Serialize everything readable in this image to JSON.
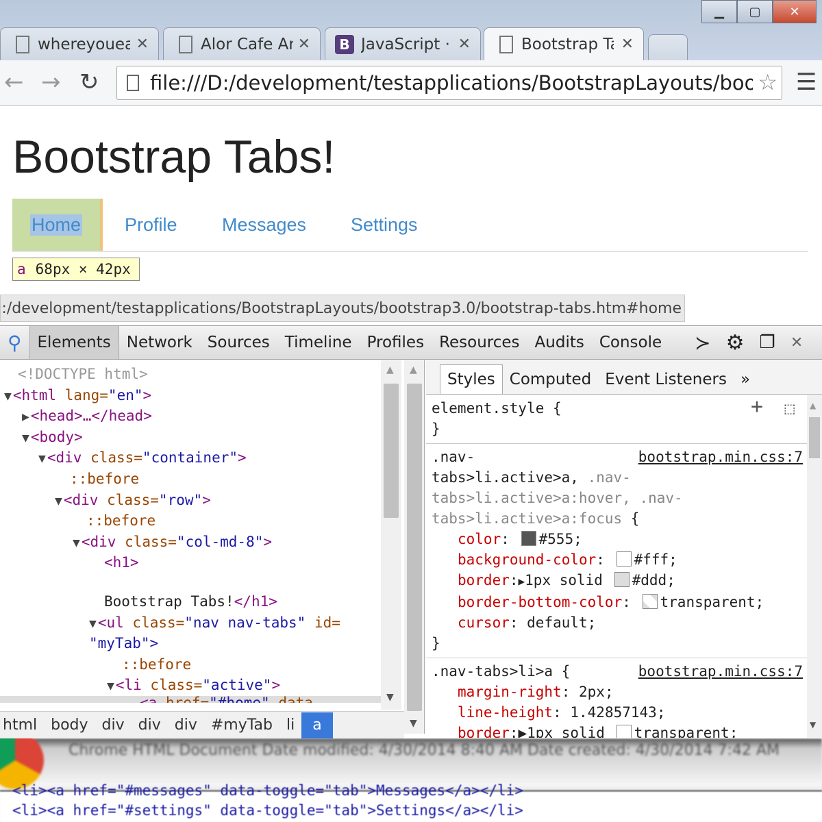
{
  "browser": {
    "tabs": [
      {
        "title": "whereyoueat",
        "icon": "page-icon"
      },
      {
        "title": "Alor Cafe An",
        "icon": "page-icon"
      },
      {
        "title": "JavaScript · B",
        "icon": "bootstrap-icon",
        "icon_letter": "B"
      },
      {
        "title": "Bootstrap Ta",
        "icon": "page-icon",
        "active": true
      }
    ],
    "close_glyph": "✕",
    "window": {
      "minimize": "▁",
      "maximize": "▢",
      "close": "✕"
    },
    "address": "file:///D:/development/testapplications/BootstrapLayouts/bootstrap3.0/bootstrap-tabs.htm#home",
    "status_url": "file:///D:/development/testapplications/BootstrapLayouts/bootstrap3.0/bootstrap-tabs.htm#home"
  },
  "page": {
    "title": "Bootstrap Tabs!",
    "tabs": [
      "Home",
      "Profile",
      "Messages",
      "Settings"
    ],
    "tooltip": {
      "tag": "a",
      "size": "68px × 42px"
    }
  },
  "devtools": {
    "tabs": [
      "Elements",
      "Network",
      "Sources",
      "Timeline",
      "Profiles",
      "Resources",
      "Audits",
      "Console"
    ],
    "dom": [
      "<!DOCTYPE html>",
      "<html lang=\"en\">",
      "<head>…</head>",
      "<body>",
      "<div class=\"container\">",
      "::before",
      "<div class=\"row\">",
      "::before",
      "<div class=\"col-md-8\">",
      "<h1>",
      "Bootstrap Tabs!</h1>",
      "<ul class=\"nav nav-tabs\" id=",
      "\"myTab\">",
      "::before",
      "<li class=\"active\">",
      "<a href=\"#home\" data-"
    ],
    "breadcrumbs": [
      "html",
      "body",
      "div",
      "div",
      "div",
      "#myTab",
      "li",
      "a"
    ],
    "styles_tabs": [
      "Styles",
      "Computed",
      "Event Listeners",
      "»"
    ],
    "rules": [
      {
        "selector": "element.style {",
        "close": "}"
      },
      {
        "selector_l1": ".nav-",
        "selector_l2": "tabs>li.active>a,",
        "selector_l2b": ".nav-",
        "selector_l3": "tabs>li.active>a:hover,",
        "selector_l3b": ".nav-",
        "selector_l4": "tabs>li.active>a:focus {",
        "source": "bootstrap.min.css:7",
        "decls": [
          {
            "prop": "color",
            "value": "#555",
            "swatch": "#555555"
          },
          {
            "prop": "background-color",
            "value": "#fff",
            "swatch": "#ffffff"
          },
          {
            "prop": "border",
            "value": "1px solid",
            "value2": "#ddd",
            "swatch": "#dddddd"
          },
          {
            "prop": "border-bottom-color",
            "value": "transparent",
            "swatch": "transparent"
          },
          {
            "prop": "cursor",
            "value": "default"
          }
        ],
        "close": "}"
      },
      {
        "selector": ".nav-tabs>li>a {",
        "source": "bootstrap.min.css:7",
        "decls": [
          {
            "prop": "margin-right",
            "value": "2px"
          },
          {
            "prop": "line-height",
            "value": "1.42857143"
          },
          {
            "prop": "border",
            "value": "1px solid",
            "value2": "transparent"
          }
        ]
      }
    ]
  },
  "overlay": {
    "file_info": "Chrome HTML Document  Date modified: 4/30/2014 8:40 AM          Date created: 4/30/2014 7:42 AM",
    "code_lines": [
      "<li><a href=\"#messages\" data-toggle=\"tab\">Messages</a></li>",
      "<li><a href=\"#settings\" data-toggle=\"tab\">Settings</a></li>"
    ]
  }
}
